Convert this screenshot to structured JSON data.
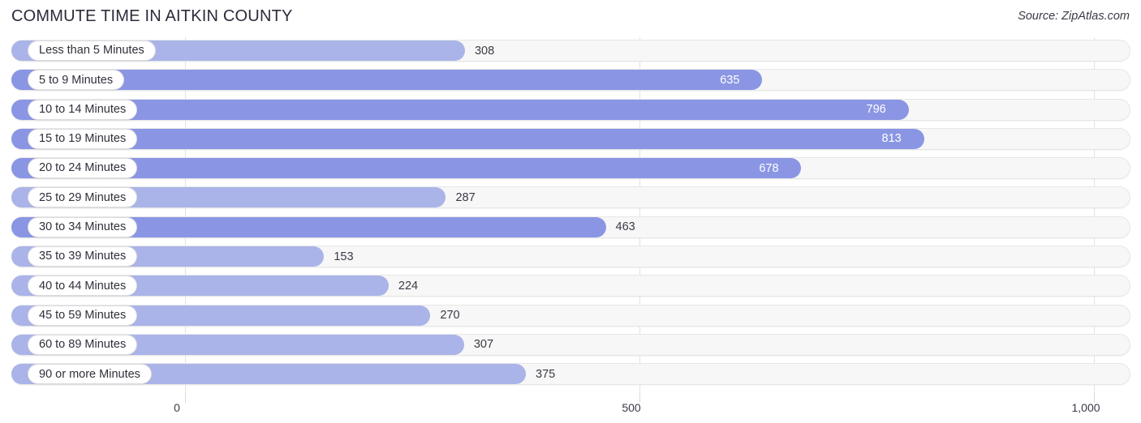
{
  "header": {
    "title": "COMMUTE TIME IN AITKIN COUNTY",
    "source": "Source: ZipAtlas.com"
  },
  "colors": {
    "bar_light": "#aab4e8",
    "bar_dark": "#8a96e4",
    "track": "#f7f7f7",
    "gridline": "#e2e2e6",
    "title_text": "#2b2b3b"
  },
  "chart_data": {
    "type": "bar",
    "orientation": "horizontal",
    "title": "COMMUTE TIME IN AITKIN COUNTY",
    "xlabel": "",
    "ylabel": "",
    "xlim": [
      0,
      1000
    ],
    "grid": true,
    "legend": false,
    "source": "Source: ZipAtlas.com",
    "ticks": [
      "0",
      "500",
      "1,000"
    ],
    "tick_values": [
      0,
      500,
      1000
    ],
    "categories": [
      "Less than 5 Minutes",
      "5 to 9 Minutes",
      "10 to 14 Minutes",
      "15 to 19 Minutes",
      "20 to 24 Minutes",
      "25 to 29 Minutes",
      "30 to 34 Minutes",
      "35 to 39 Minutes",
      "40 to 44 Minutes",
      "45 to 59 Minutes",
      "60 to 89 Minutes",
      "90 or more Minutes"
    ],
    "values": [
      308,
      635,
      796,
      813,
      678,
      287,
      463,
      153,
      224,
      270,
      307,
      375
    ],
    "value_labels": [
      "308",
      "635",
      "796",
      "813",
      "678",
      "287",
      "463",
      "153",
      "224",
      "270",
      "307",
      "375"
    ],
    "rows": [
      {
        "label": "Less than 5 Minutes",
        "value": 308,
        "value_label": "308",
        "shade": "light",
        "label_inside": false
      },
      {
        "label": "5 to 9 Minutes",
        "value": 635,
        "value_label": "635",
        "shade": "dark",
        "label_inside": true
      },
      {
        "label": "10 to 14 Minutes",
        "value": 796,
        "value_label": "796",
        "shade": "dark",
        "label_inside": true
      },
      {
        "label": "15 to 19 Minutes",
        "value": 813,
        "value_label": "813",
        "shade": "dark",
        "label_inside": true
      },
      {
        "label": "20 to 24 Minutes",
        "value": 678,
        "value_label": "678",
        "shade": "dark",
        "label_inside": true
      },
      {
        "label": "25 to 29 Minutes",
        "value": 287,
        "value_label": "287",
        "shade": "light",
        "label_inside": false
      },
      {
        "label": "30 to 34 Minutes",
        "value": 463,
        "value_label": "463",
        "shade": "dark",
        "label_inside": false
      },
      {
        "label": "35 to 39 Minutes",
        "value": 153,
        "value_label": "153",
        "shade": "light",
        "label_inside": false
      },
      {
        "label": "40 to 44 Minutes",
        "value": 224,
        "value_label": "224",
        "shade": "light",
        "label_inside": false
      },
      {
        "label": "45 to 59 Minutes",
        "value": 270,
        "value_label": "270",
        "shade": "light",
        "label_inside": false
      },
      {
        "label": "60 to 89 Minutes",
        "value": 307,
        "value_label": "307",
        "shade": "light",
        "label_inside": false
      },
      {
        "label": "90 or more Minutes",
        "value": 375,
        "value_label": "375",
        "shade": "light",
        "label_inside": false
      }
    ]
  }
}
